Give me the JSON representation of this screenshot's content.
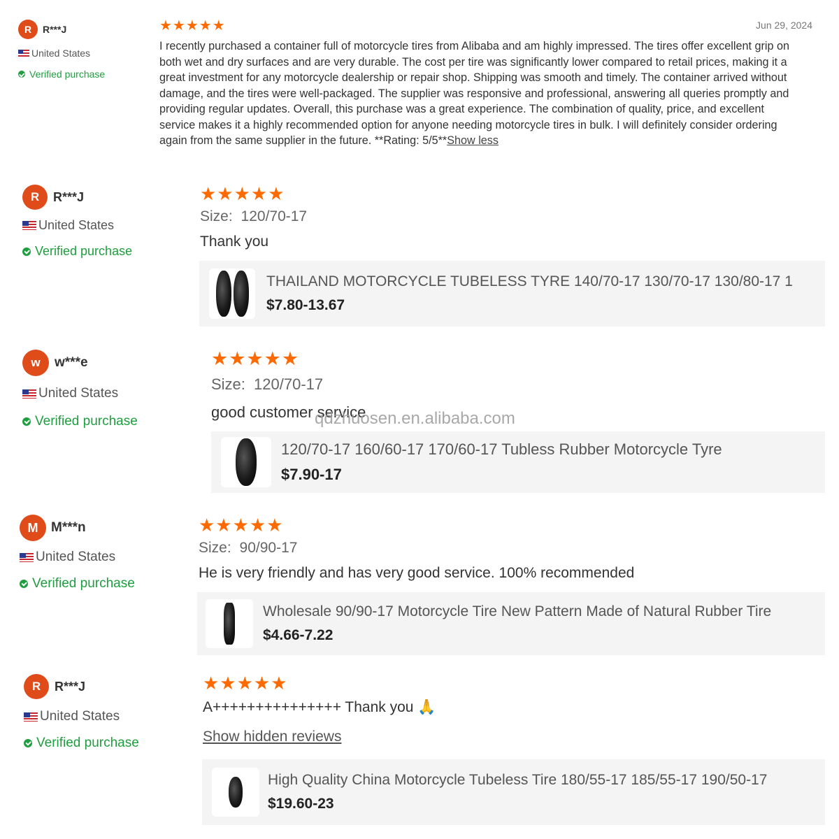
{
  "watermark": "qdzhuosen.en.alibaba.com",
  "reviews": [
    {
      "avatar": "R",
      "name": "R***J",
      "country": "United States",
      "verified": "Verified purchase",
      "date": "Jun 29, 2024",
      "stars": "★★★★★",
      "text": "I recently purchased a container full of motorcycle tires from Alibaba and am highly impressed. The tires offer excellent grip on both wet and dry surfaces and are very durable. The cost per tire was significantly lower compared to retail prices, making it a great investment for any motorcycle dealership or repair shop. Shipping was smooth and timely. The container arrived without damage, and the tires were well-packaged. The supplier was responsive and professional, answering all queries promptly and providing regular updates. Overall, this purchase was a great experience. The combination of quality, price, and excellent service makes it a highly recommended option for anyone needing motorcycle tires in bulk. I will definitely consider ordering again from the same supplier in the future. **Rating: 5/5**",
      "toggle": "Show less"
    },
    {
      "avatar": "R",
      "name": "R***J",
      "country": "United States",
      "verified": "Verified purchase",
      "stars": "★★★★★",
      "size_label": "Size:",
      "size": "120/70-17",
      "text": "Thank you",
      "product_title": "THAILAND MOTORCYCLE TUBELESS TYRE 140/70-17 130/70-17 130/80-17 1",
      "product_price": "$7.80-13.67"
    },
    {
      "avatar": "w",
      "name": "w***e",
      "country": "United States",
      "verified": "Verified purchase",
      "stars": "★★★★★",
      "size_label": "Size:",
      "size": "120/70-17",
      "text": "good customer service",
      "product_title": "120/70-17 160/60-17 170/60-17 Tubless Rubber Motorcycle Tyre",
      "product_price": "$7.90-17"
    },
    {
      "avatar": "M",
      "name": "M***n",
      "country": "United States",
      "verified": "Verified purchase",
      "stars": "★★★★★",
      "size_label": "Size:",
      "size": "90/90-17",
      "text": "He is very friendly and has very good service. 100% recommended",
      "product_title": "Wholesale 90/90-17 Motorcycle Tire New Pattern Made of Natural Rubber Tire",
      "product_price": "$4.66-7.22"
    },
    {
      "avatar": "R",
      "name": "R***J",
      "country": "United States",
      "verified": "Verified purchase",
      "stars": "★★★★★",
      "text": "A+++++++++++++++ Thank you 🙏",
      "hidden_link": "Show hidden reviews",
      "product_title": "High Quality China Motorcycle Tubeless Tire 180/55-17 185/55-17 190/50-17",
      "product_price": "$19.60-23"
    }
  ]
}
